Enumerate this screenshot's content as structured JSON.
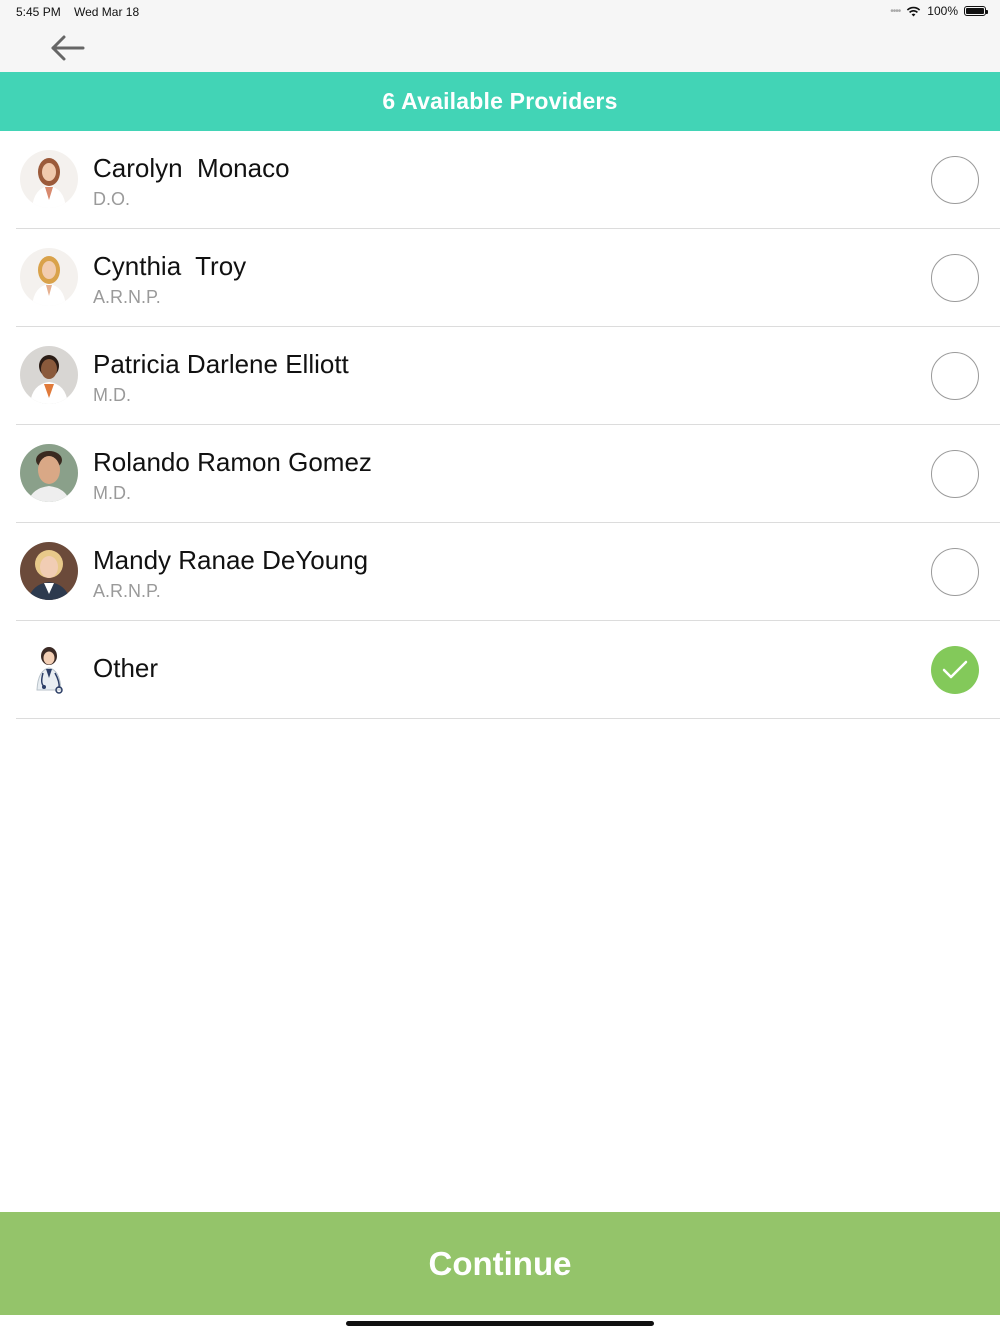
{
  "status_bar": {
    "time": "5:45 PM",
    "date": "Wed Mar 18",
    "battery": "100%"
  },
  "nav": {
    "back_icon": "arrow-left-icon"
  },
  "header": {
    "title": "6 Available Providers",
    "color": "#42d4b6"
  },
  "providers": [
    {
      "name": "Carolyn  Monaco",
      "credential": "D.O.",
      "selected": false
    },
    {
      "name": "Cynthia  Troy",
      "credential": "A.R.N.P.",
      "selected": false
    },
    {
      "name": "Patricia Darlene Elliott",
      "credential": "M.D.",
      "selected": false
    },
    {
      "name": "Rolando Ramon Gomez",
      "credential": "M.D.",
      "selected": false
    },
    {
      "name": "Mandy Ranae DeYoung",
      "credential": "A.R.N.P.",
      "selected": false
    },
    {
      "name": "Other",
      "credential": "",
      "selected": true
    }
  ],
  "continue_button": {
    "label": "Continue",
    "color": "#94c46a"
  },
  "check_color": "#83c95a"
}
